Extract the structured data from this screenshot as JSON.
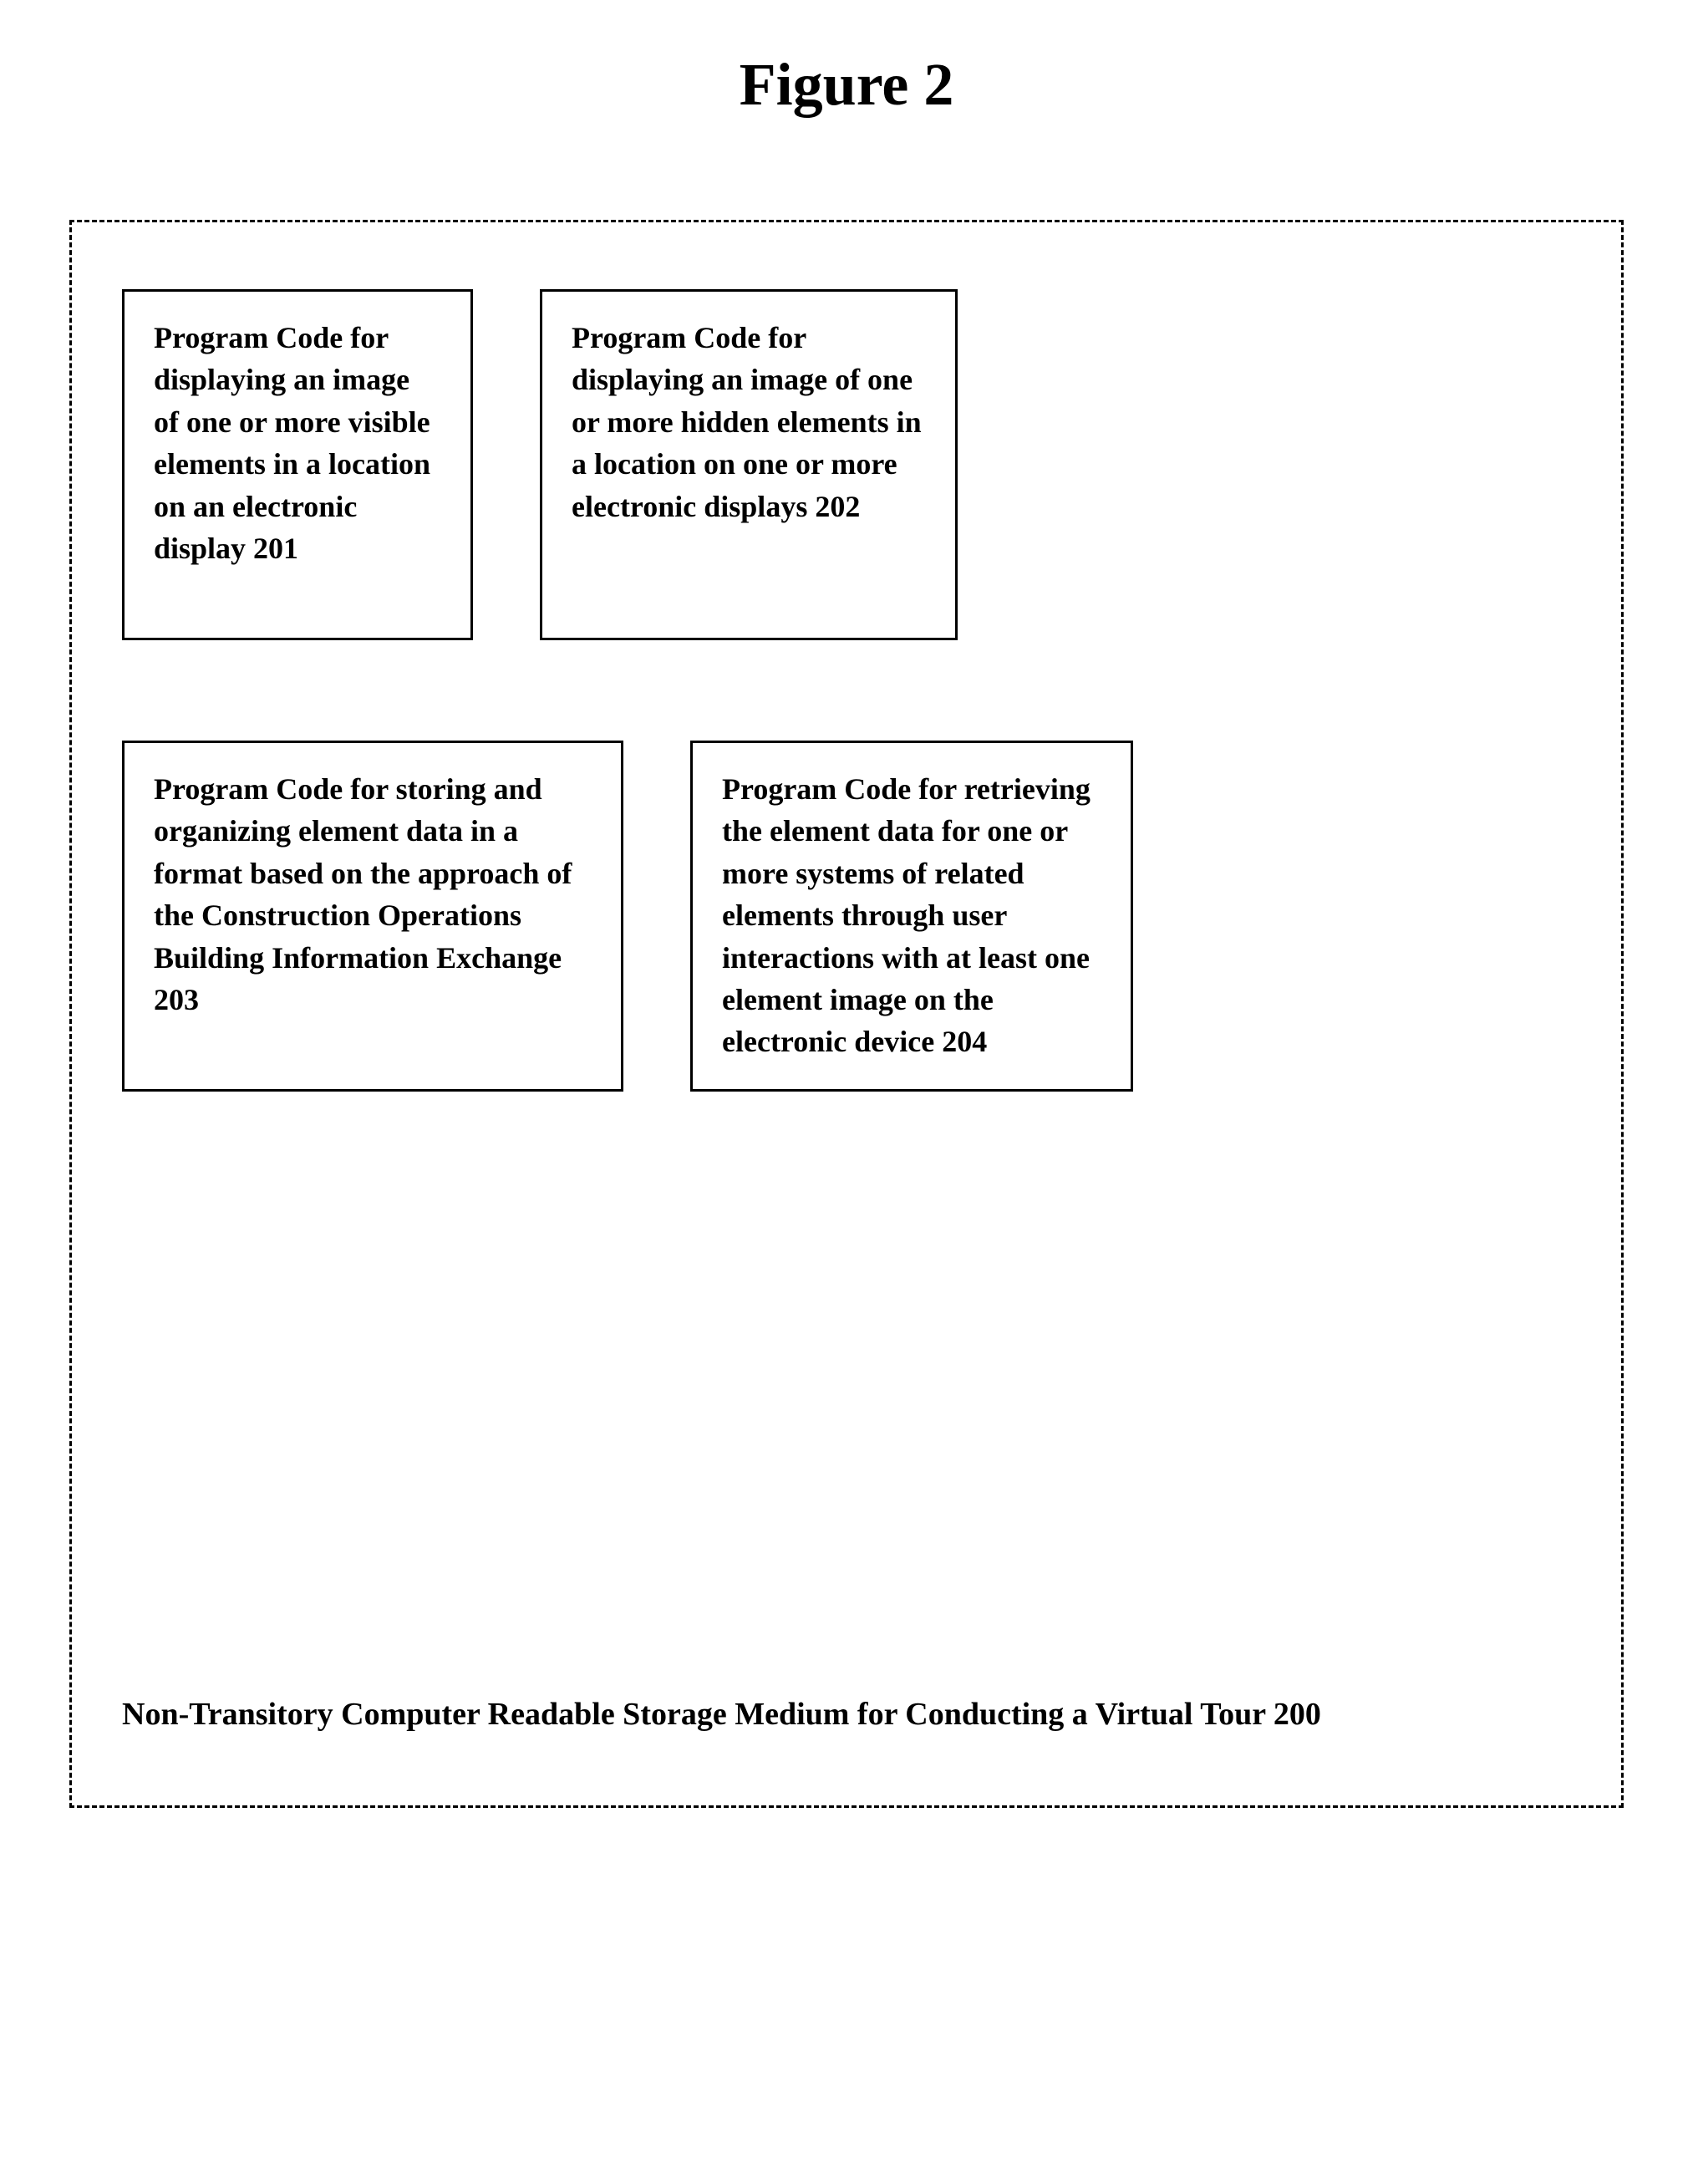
{
  "figure": {
    "title": "Figure 2"
  },
  "boxes": {
    "box201": {
      "text": "Program Code for displaying an image of one or more visible elements in a location on an electronic display 201"
    },
    "box202": {
      "text": "Program Code for displaying an image of one or more hidden elements in a location on one or more electronic displays 202"
    },
    "box203": {
      "text": "Program Code for storing and organizing element data in a format based on the approach of the Construction Operations Building Information Exchange 203"
    },
    "box204": {
      "text": "Program Code for retrieving the element data for one or more systems of related elements through user interactions with at least one element image on the electronic device 204"
    },
    "label200": {
      "text": "Non-Transitory Computer Readable Storage Medium for Conducting a Virtual Tour 200"
    }
  }
}
